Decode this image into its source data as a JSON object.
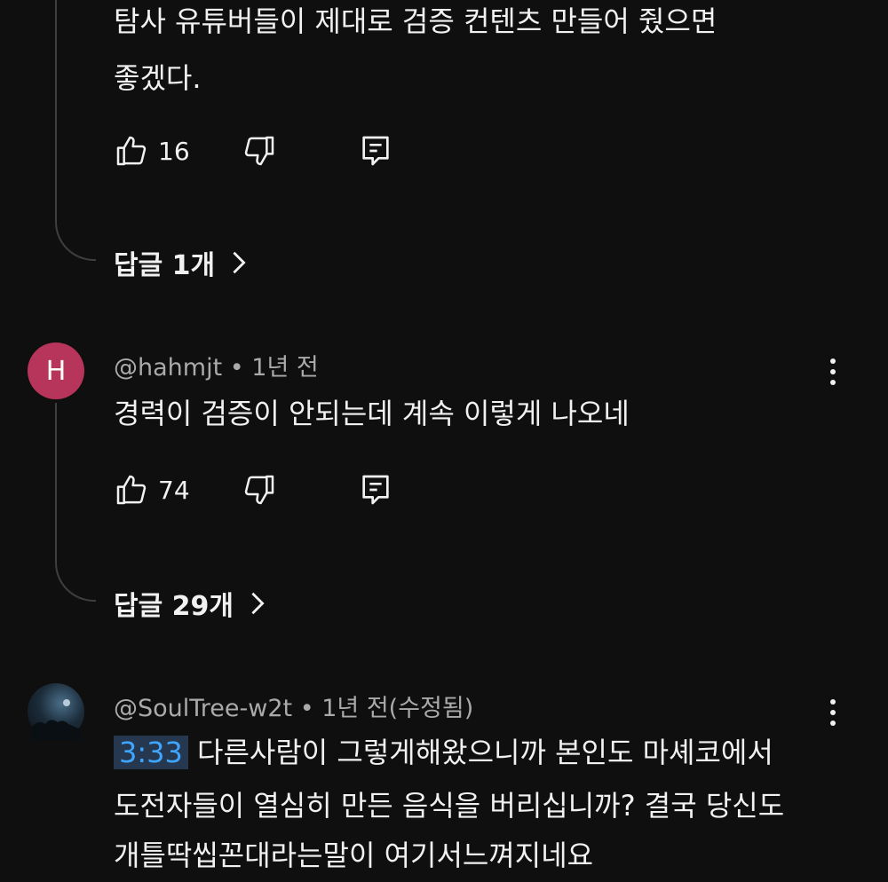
{
  "comments": [
    {
      "text_lines": [
        "탐사 유튜버들이 제대로 검증 컨텐츠 만들어 줬으면",
        "좋겠다."
      ],
      "likes": "16",
      "replies_label": "답글 1개"
    },
    {
      "avatar_letter": "H",
      "avatar_color": "#b7355a",
      "author": "@hahmjt",
      "age": "1년 전",
      "text_lines": [
        "경력이 검증이 안되는데 계속 이렇게 나오네"
      ],
      "likes": "74",
      "replies_label": "답글 29개"
    },
    {
      "author": "@SoulTree-w2t",
      "age": "1년 전(수정됨)",
      "timestamp_link": "3:33",
      "text_lines": [
        "다른사람이 그렇게해왔으니까 본인도 마셰코에서",
        "도전자들이 열심히 만든 음식을 버리십니까? 결국 당신도",
        "개틀딱씹꼰대라는말이 여기서느껴지네요"
      ]
    }
  ],
  "icons": {
    "like": "thumbs-up-icon",
    "dislike": "thumbs-down-icon",
    "reply": "comment-icon",
    "more": "more-vert-icon",
    "chevron": "chevron-right-icon"
  },
  "colors": {
    "background": "#0f0f0f",
    "link": "#3ea6ff",
    "meta": "#aaaaaa"
  }
}
